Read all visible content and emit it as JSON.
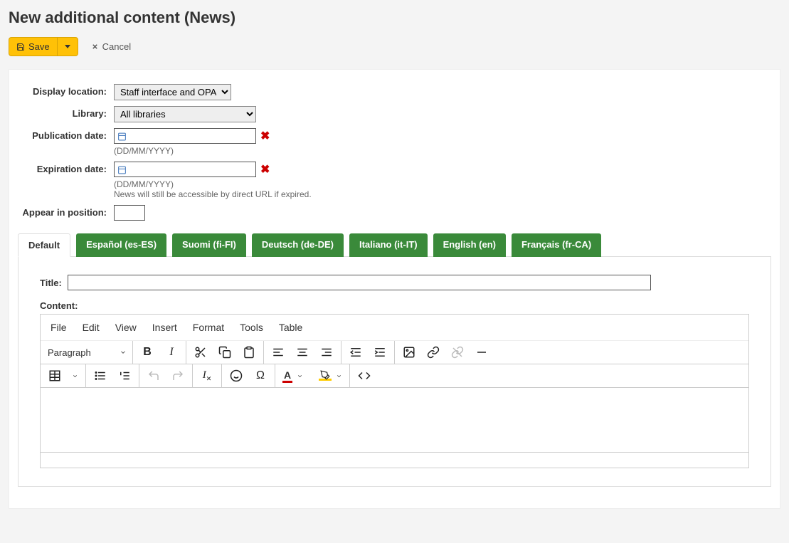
{
  "heading": "New additional content (News)",
  "toolbar": {
    "save_label": "Save",
    "cancel_label": "Cancel"
  },
  "form": {
    "display_location_label": "Display location:",
    "display_location_value": "Staff interface and OPAC",
    "library_label": "Library:",
    "library_value": "All libraries",
    "pub_date_label": "Publication date:",
    "pub_date_hint": "(DD/MM/YYYY)",
    "exp_date_label": "Expiration date:",
    "exp_date_hint": "(DD/MM/YYYY)",
    "exp_date_note": "News will still be accessible by direct URL if expired.",
    "position_label": "Appear in position:"
  },
  "tabs": [
    "Default",
    "Español (es-ES)",
    "Suomi (fi-FI)",
    "Deutsch (de-DE)",
    "Italiano (it-IT)",
    "English (en)",
    "Français (fr-CA)"
  ],
  "tab_content": {
    "title_label": "Title:",
    "content_label": "Content:"
  },
  "editor": {
    "menus": [
      "File",
      "Edit",
      "View",
      "Insert",
      "Format",
      "Tools",
      "Table"
    ],
    "paragraph_label": "Paragraph"
  }
}
